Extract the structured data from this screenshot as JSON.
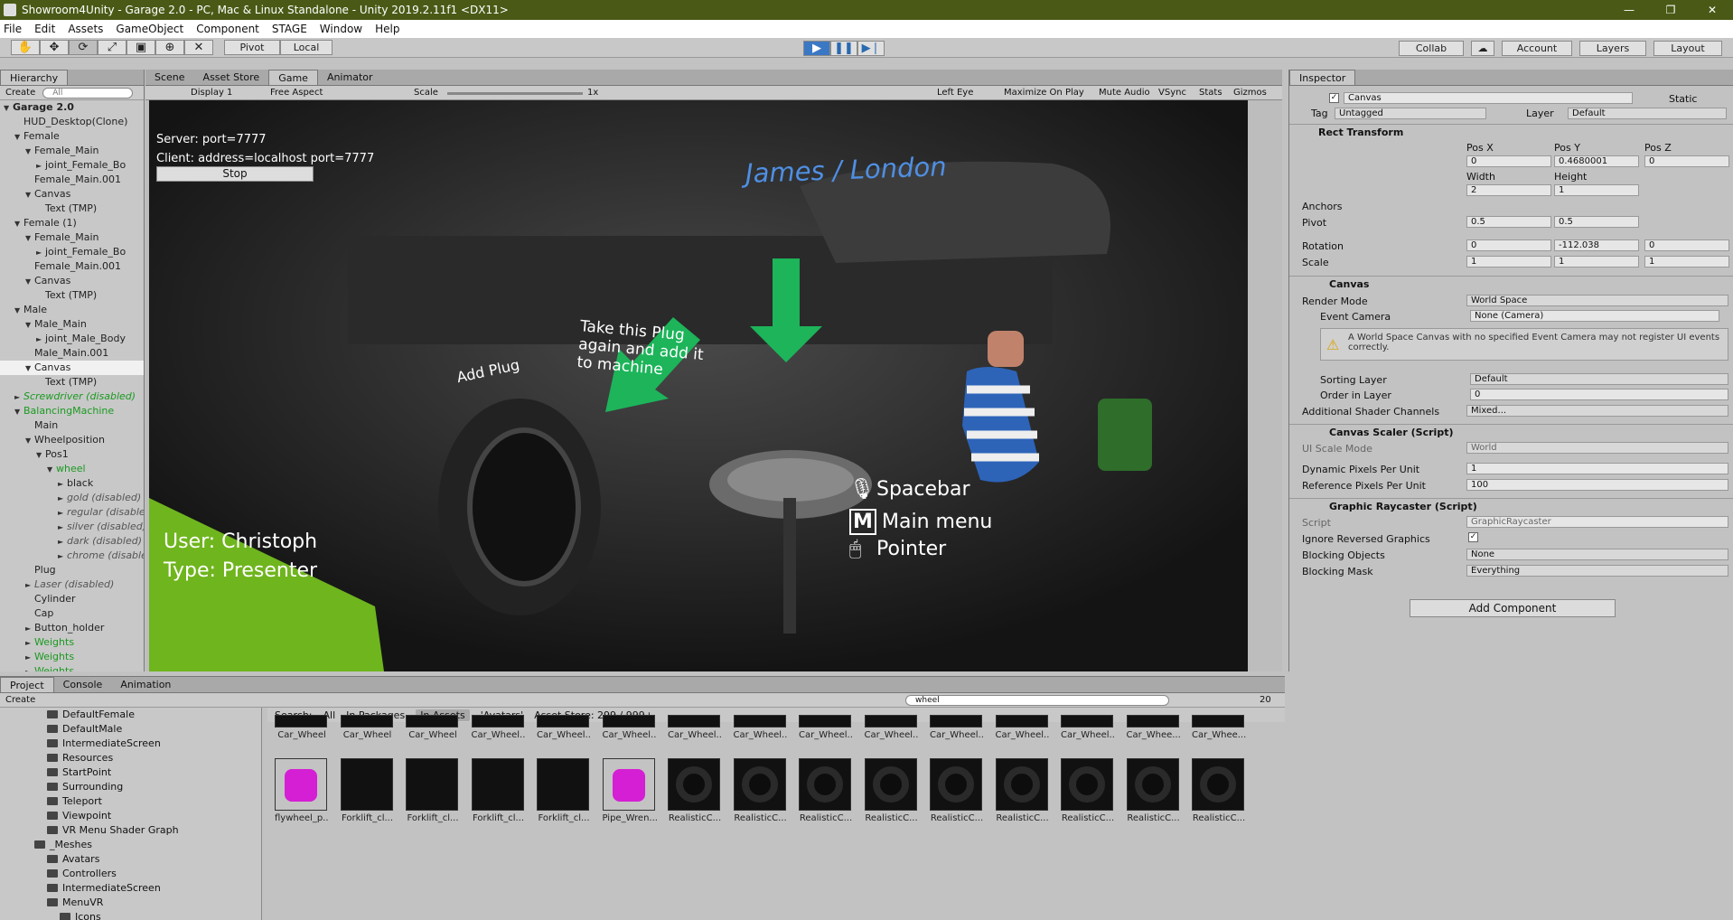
{
  "window": {
    "title": "Showroom4Unity - Garage 2.0 - PC, Mac & Linux Standalone - Unity 2019.2.11f1 <DX11>"
  },
  "menu": [
    "File",
    "Edit",
    "Assets",
    "GameObject",
    "Component",
    "STAGE",
    "Window",
    "Help"
  ],
  "toolbar": {
    "pivot": "Pivot",
    "local": "Local",
    "collab": "Collab",
    "account": "Account",
    "layers": "Layers",
    "layout": "Layout"
  },
  "hierarchy": {
    "tab": "Hierarchy",
    "create": "Create",
    "search": "All",
    "items": [
      {
        "label": "Garage 2.0",
        "depth": 0,
        "arrow": "▼",
        "style": "bold"
      },
      {
        "label": "HUD_Desktop(Clone)",
        "depth": 1,
        "arrow": "",
        "style": ""
      },
      {
        "label": "Female",
        "depth": 1,
        "arrow": "▼",
        "style": ""
      },
      {
        "label": "Female_Main",
        "depth": 2,
        "arrow": "▼",
        "style": ""
      },
      {
        "label": "joint_Female_Bo",
        "depth": 3,
        "arrow": "►",
        "style": ""
      },
      {
        "label": "Female_Main.001",
        "depth": 2,
        "arrow": "",
        "style": ""
      },
      {
        "label": "Canvas",
        "depth": 2,
        "arrow": "▼",
        "style": ""
      },
      {
        "label": "Text (TMP)",
        "depth": 3,
        "arrow": "",
        "style": ""
      },
      {
        "label": "Female (1)",
        "depth": 1,
        "arrow": "▼",
        "style": ""
      },
      {
        "label": "Female_Main",
        "depth": 2,
        "arrow": "▼",
        "style": ""
      },
      {
        "label": "joint_Female_Bo",
        "depth": 3,
        "arrow": "►",
        "style": ""
      },
      {
        "label": "Female_Main.001",
        "depth": 2,
        "arrow": "",
        "style": ""
      },
      {
        "label": "Canvas",
        "depth": 2,
        "arrow": "▼",
        "style": ""
      },
      {
        "label": "Text (TMP)",
        "depth": 3,
        "arrow": "",
        "style": ""
      },
      {
        "label": "Male",
        "depth": 1,
        "arrow": "▼",
        "style": ""
      },
      {
        "label": "Male_Main",
        "depth": 2,
        "arrow": "▼",
        "style": ""
      },
      {
        "label": "joint_Male_Body",
        "depth": 3,
        "arrow": "►",
        "style": ""
      },
      {
        "label": "Male_Main.001",
        "depth": 2,
        "arrow": "",
        "style": ""
      },
      {
        "label": "Canvas",
        "depth": 2,
        "arrow": "▼",
        "style": "sel"
      },
      {
        "label": "Text (TMP)",
        "depth": 3,
        "arrow": "",
        "style": ""
      },
      {
        "label": "Screwdriver (disabled)",
        "depth": 1,
        "arrow": "►",
        "style": "dis green"
      },
      {
        "label": "BalancingMachine",
        "depth": 1,
        "arrow": "▼",
        "style": "green"
      },
      {
        "label": "Main",
        "depth": 2,
        "arrow": "",
        "style": ""
      },
      {
        "label": "Wheelposition",
        "depth": 2,
        "arrow": "▼",
        "style": ""
      },
      {
        "label": "Pos1",
        "depth": 3,
        "arrow": "▼",
        "style": ""
      },
      {
        "label": "wheel",
        "depth": 4,
        "arrow": "▼",
        "style": "green"
      },
      {
        "label": "black",
        "depth": 5,
        "arrow": "►",
        "style": ""
      },
      {
        "label": "gold (disabled)",
        "depth": 5,
        "arrow": "►",
        "style": "dis"
      },
      {
        "label": "regular (disabled)",
        "depth": 5,
        "arrow": "►",
        "style": "dis"
      },
      {
        "label": "silver (disabled)",
        "depth": 5,
        "arrow": "►",
        "style": "dis"
      },
      {
        "label": "dark (disabled)",
        "depth": 5,
        "arrow": "►",
        "style": "dis"
      },
      {
        "label": "chrome (disabled)",
        "depth": 5,
        "arrow": "►",
        "style": "dis"
      },
      {
        "label": "Plug",
        "depth": 2,
        "arrow": "",
        "style": ""
      },
      {
        "label": "Laser (disabled)",
        "depth": 2,
        "arrow": "►",
        "style": "dis"
      },
      {
        "label": "Cylinder",
        "depth": 2,
        "arrow": "",
        "style": ""
      },
      {
        "label": "Cap",
        "depth": 2,
        "arrow": "",
        "style": ""
      },
      {
        "label": "Button_holder",
        "depth": 2,
        "arrow": "►",
        "style": ""
      },
      {
        "label": "Weights",
        "depth": 2,
        "arrow": "►",
        "style": "green"
      },
      {
        "label": "Weights",
        "depth": 2,
        "arrow": "►",
        "style": "green"
      },
      {
        "label": "Weights",
        "depth": 2,
        "arrow": "►",
        "style": "green"
      }
    ]
  },
  "gametabs": {
    "scene": "Scene",
    "store": "Asset Store",
    "game": "Game",
    "animator": "Animator"
  },
  "gamebar": {
    "display": "Display 1",
    "aspect": "Free Aspect",
    "scale": "Scale",
    "scale_val": "1x",
    "eye": "Left Eye",
    "maximize": "Maximize On Play",
    "mute": "Mute Audio",
    "vsync": "VSync",
    "stats": "Stats",
    "gizmos": "Gizmos"
  },
  "gameview": {
    "server": "Server: port=7777",
    "client": "Client: address=localhost port=7777",
    "stop": "Stop",
    "name": "James / London",
    "add_plug": "Add Plug",
    "take_plug": "Take this Plug again and add it to machine",
    "user": "User: Christoph",
    "type": "Type: Presenter",
    "spacebar": "Spacebar",
    "mainmenu": "Main menu",
    "pointer": "Pointer"
  },
  "inspector": {
    "tab": "Inspector",
    "name": "Canvas",
    "static": "Static",
    "tag": "Tag",
    "tag_val": "Untagged",
    "layer": "Layer",
    "layer_val": "Default",
    "rect": "Rect Transform",
    "posx": "Pos X",
    "posy": "Pos Y",
    "posz": "Pos Z",
    "posx_v": "0",
    "posy_v": "0.4680001",
    "posz_v": "0",
    "width": "Width",
    "height": "Height",
    "width_v": "2",
    "height_v": "1",
    "anchors": "Anchors",
    "pivot": "Pivot",
    "pivot_x": "0.5",
    "pivot_y": "0.5",
    "rotation": "Rotation",
    "rot_x": "0",
    "rot_y": "-112.038",
    "rot_z": "0",
    "scale": "Scale",
    "sc_x": "1",
    "sc_y": "1",
    "sc_z": "1",
    "canvas": "Canvas",
    "render_mode": "Render Mode",
    "render_mode_v": "World Space",
    "event_camera": "Event Camera",
    "event_camera_v": "None (Camera)",
    "warning": "A World Space Canvas with no specified Event Camera may not register UI events correctly.",
    "sorting": "Sorting Layer",
    "sorting_v": "Default",
    "order": "Order in Layer",
    "order_v": "0",
    "shader": "Additional Shader Channels",
    "shader_v": "Mixed...",
    "scaler": "Canvas Scaler (Script)",
    "ui_scale": "UI Scale Mode",
    "ui_scale_v": "World",
    "dppu": "Dynamic Pixels Per Unit",
    "dppu_v": "1",
    "rppu": "Reference Pixels Per Unit",
    "rppu_v": "100",
    "raycaster": "Graphic Raycaster (Script)",
    "script": "Script",
    "script_v": "GraphicRaycaster",
    "ignore": "Ignore Reversed Graphics",
    "blocking": "Blocking Objects",
    "blocking_v": "None",
    "mask": "Blocking Mask",
    "mask_v": "Everything",
    "add": "Add Component"
  },
  "project": {
    "tabs": [
      "Project",
      "Console",
      "Animation"
    ],
    "create": "Create",
    "search_v": "wheel",
    "count": "20",
    "tree": [
      {
        "label": "DefaultFemale",
        "depth": 3
      },
      {
        "label": "DefaultMale",
        "depth": 3
      },
      {
        "label": "IntermediateScreen",
        "depth": 3
      },
      {
        "label": "Resources",
        "depth": 3
      },
      {
        "label": "StartPoint",
        "depth": 3
      },
      {
        "label": "Surrounding",
        "depth": 3
      },
      {
        "label": "Teleport",
        "depth": 3
      },
      {
        "label": "Viewpoint",
        "depth": 3
      },
      {
        "label": "VR Menu Shader Graph",
        "depth": 3
      },
      {
        "label": "_Meshes",
        "depth": 2
      },
      {
        "label": "Avatars",
        "depth": 3
      },
      {
        "label": "Controllers",
        "depth": 3
      },
      {
        "label": "IntermediateScreen",
        "depth": 3
      },
      {
        "label": "MenuVR",
        "depth": 3
      },
      {
        "label": "Icons",
        "depth": 4
      }
    ],
    "searchbar": {
      "label": "Search:",
      "all": "All",
      "packages": "In Packages",
      "assets": "In Assets",
      "avatars": "'Avatars'",
      "store": "Asset Store: 299 / 999+"
    },
    "row1": [
      "Car_Wheel",
      "Car_Wheel",
      "Car_Wheel",
      "Car_Wheel...",
      "Car_Wheel...",
      "Car_Wheel...",
      "Car_Wheel...",
      "Car_Wheel...",
      "Car_Wheel...",
      "Car_Wheel...",
      "Car_Wheel...",
      "Car_Wheel...",
      "Car_Wheel...",
      "Car_Whee...",
      "Car_Whee..."
    ],
    "row2": [
      "flywheel_p...",
      "Forklift_cl...",
      "Forklift_cl...",
      "Forklift_cl...",
      "Forklift_cl...",
      "Pipe_Wren...",
      "RealisticC...",
      "RealisticC...",
      "RealisticC...",
      "RealisticC...",
      "RealisticC...",
      "RealisticC...",
      "RealisticC...",
      "RealisticC...",
      "RealisticC..."
    ]
  }
}
